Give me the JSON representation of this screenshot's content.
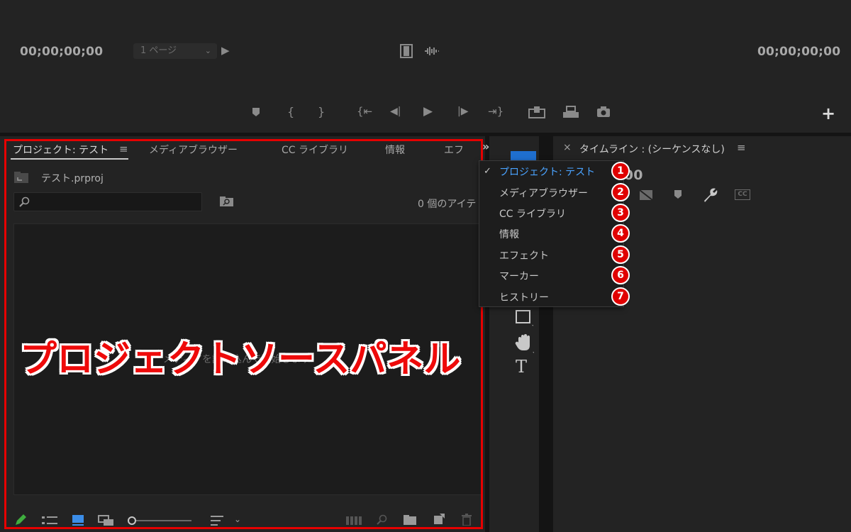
{
  "monitor": {
    "timecode_in": "00;00;00;00",
    "timecode_out": "00;00;00;00",
    "page_select": "1 ページ"
  },
  "project_panel": {
    "tabs": [
      "プロジェクト: テスト",
      "メディアブラウザー",
      "CC ライブラリ",
      "情報",
      "エフ"
    ],
    "file_name": "テスト.prproj",
    "item_count": "0 個のアイテ",
    "hint": "メディアを読み込んで開始します"
  },
  "timeline": {
    "title": "タイムライン : (シーケンスなし)",
    "timecode": "00;00;00;00",
    "timecode_visible": ";00"
  },
  "panel_menu": {
    "items": [
      {
        "label": "プロジェクト: テスト",
        "badge": "1",
        "checked": true
      },
      {
        "label": "メディアブラウザー",
        "badge": "2"
      },
      {
        "label": "CC ライブラリ",
        "badge": "3"
      },
      {
        "label": "情報",
        "badge": "4"
      },
      {
        "label": "エフェクト",
        "badge": "5"
      },
      {
        "label": "マーカー",
        "badge": "6"
      },
      {
        "label": "ヒストリー",
        "badge": "7"
      }
    ]
  },
  "annotation": {
    "label": "プロジェクトソースパネル",
    "color": "#ee0a0a"
  },
  "colors": {
    "background": "#232323",
    "accent": "#4aa3ff",
    "highlight_red": "#e60000"
  }
}
